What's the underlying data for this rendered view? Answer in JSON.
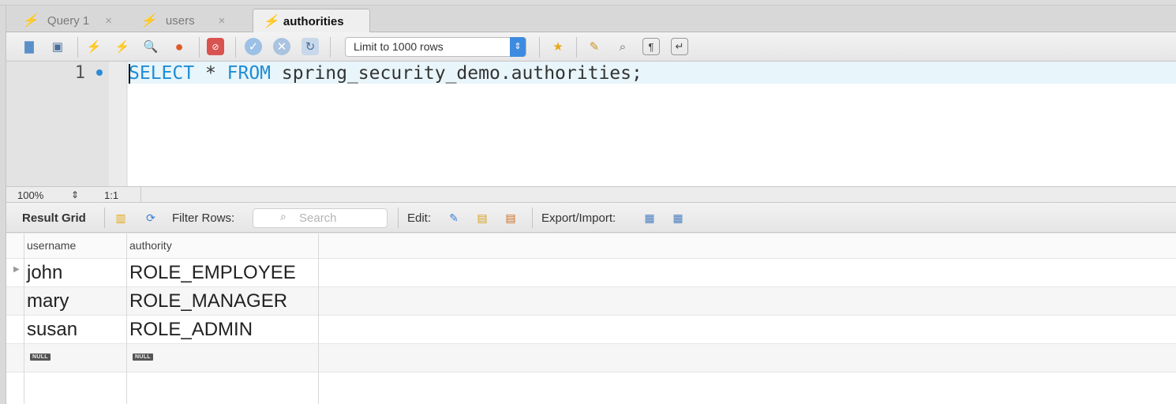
{
  "tabs": [
    {
      "label": "Query 1",
      "active": false
    },
    {
      "label": "users",
      "active": false
    },
    {
      "label": "authorities",
      "active": true
    }
  ],
  "toolbar": {
    "limit_select": "Limit to 1000 rows",
    "icons": [
      "open-folder-icon",
      "save-icon",
      "execute-icon",
      "execute-current-icon",
      "explain-icon",
      "stop-icon",
      "toggle-errors-icon",
      "commit-icon",
      "rollback-icon",
      "autocommit-icon",
      "bookmark-icon",
      "beautify-icon",
      "find-icon",
      "invisibles-icon",
      "wrap-icon"
    ]
  },
  "editor": {
    "line_number": "1",
    "keyword_select": "SELECT",
    "star": " * ",
    "keyword_from": "FROM",
    "rest": " spring_security_demo.authorities;"
  },
  "statusbar": {
    "zoom": "100%",
    "cursor": "1:1"
  },
  "result_toolbar": {
    "result_grid": "Result Grid",
    "filter_rows": "Filter Rows:",
    "search_placeholder": "Search",
    "edit": "Edit:",
    "export_import": "Export/Import:"
  },
  "grid": {
    "columns": [
      "username",
      "authority"
    ],
    "rows": [
      [
        "john",
        "ROLE_EMPLOYEE"
      ],
      [
        "mary",
        "ROLE_MANAGER"
      ],
      [
        "susan",
        "ROLE_ADMIN"
      ]
    ],
    "null_label": "NULL"
  },
  "colors": {
    "keyword": "#1f8dd6",
    "accent": "#3d8be0",
    "line_highlight": "#e8f5fa"
  }
}
